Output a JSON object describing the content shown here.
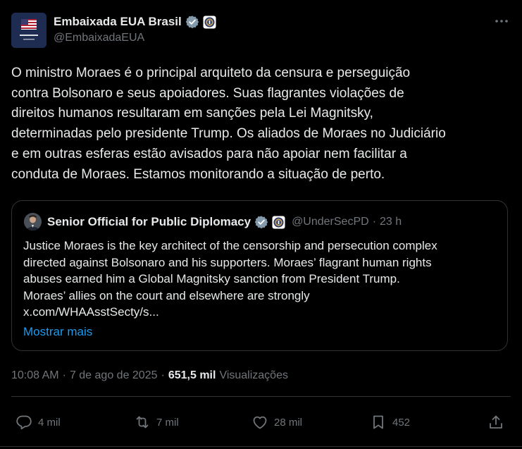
{
  "author": {
    "display_name": "Embaixada EUA Brasil",
    "handle": "@EmbaixadaEUA",
    "avatar_text": "U.S. EMBASSY BRASIL"
  },
  "tweet": {
    "lines": [
      "O ministro Moraes é o principal arquiteto da censura e perseguição",
      "contra Bolsonaro e seus apoiadores. Suas flagrantes violações de",
      "direitos humanos resultaram em sanções pela Lei Magnitsky,",
      "determinadas pelo presidente Trump. Os aliados de Moraes no Judiciário",
      "e em outras esferas estão avisados para não apoiar nem facilitar a",
      "conduta de Moraes. Estamos monitorando a situação de perto."
    ]
  },
  "quote": {
    "display_name": "Senior Official for Public Diplomacy",
    "handle": "@UnderSecPD",
    "separator": "·",
    "time": "23 h",
    "lines": [
      "Justice Moraes is the key architect of the censorship and persecution complex",
      "directed against Bolsonaro and his supporters. Moraes’ flagrant human rights",
      "abuses earned him a Global Magnitsky sanction from President Trump.",
      "Moraes’ allies on the court and elsewhere are strongly",
      "x.com/WHAAsstSecty/s..."
    ],
    "show_more": "Mostrar mais"
  },
  "meta": {
    "time": "10:08 AM",
    "separator1": "·",
    "date": "7 de ago de 2025",
    "separator2": "·",
    "views_count": "651,5 mil",
    "views_label": "Visualizações"
  },
  "actions": {
    "replies": "4 mil",
    "reposts": "7 mil",
    "likes": "28 mil",
    "bookmarks": "452"
  },
  "colors": {
    "background": "#000000",
    "text": "#e7e9ea",
    "muted": "#71767b",
    "link": "#1d9bf0",
    "verified": "#829aab",
    "border": "#2f3336"
  },
  "icons": {
    "verified": "verified-badge-icon",
    "seal": "government-seal-icon",
    "more": "more-dots-icon",
    "reply": "reply-icon",
    "repost": "repost-icon",
    "like": "heart-icon",
    "bookmark": "bookmark-icon",
    "share": "share-icon"
  }
}
